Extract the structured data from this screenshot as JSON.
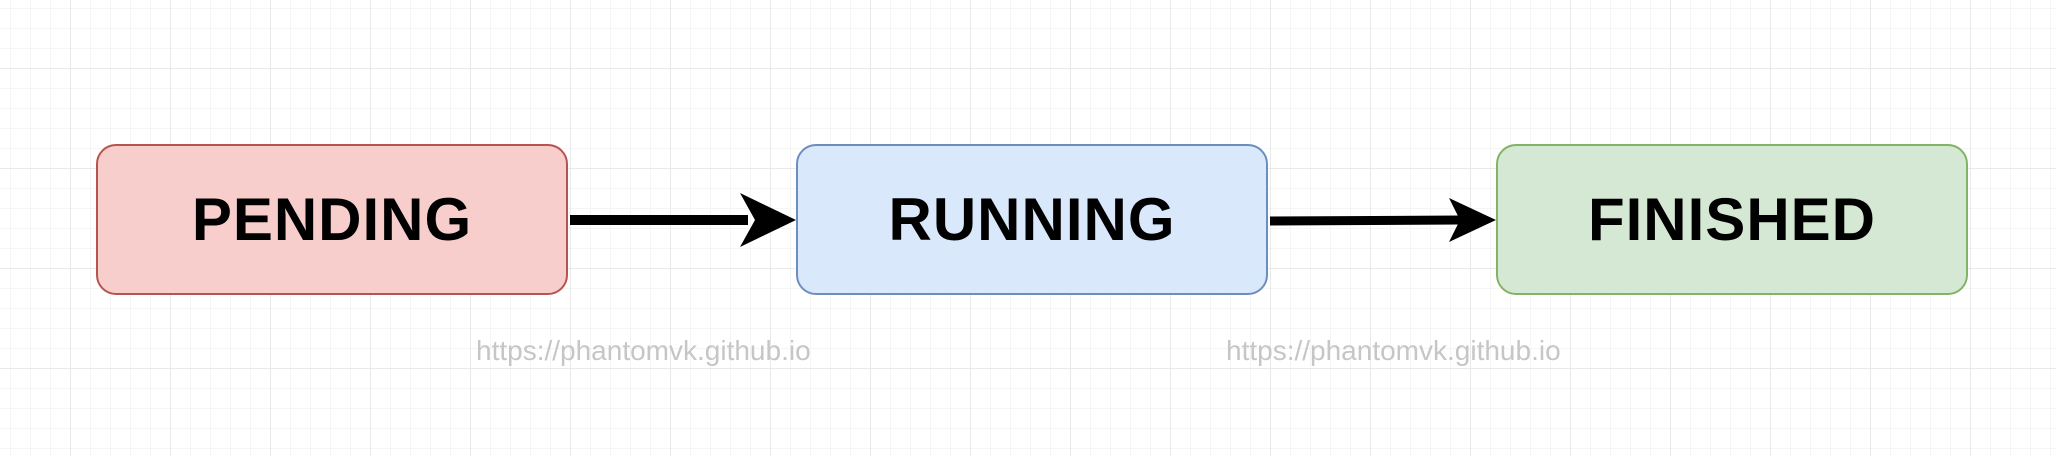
{
  "diagram": {
    "states": [
      {
        "id": "pending",
        "label": "PENDING",
        "fill": "#f8cecc",
        "stroke": "#b85450"
      },
      {
        "id": "running",
        "label": "RUNNING",
        "fill": "#dae8fc",
        "stroke": "#6c8ebf"
      },
      {
        "id": "finished",
        "label": "FINISHED",
        "fill": "#d5e8d4",
        "stroke": "#82b366"
      }
    ],
    "transitions": [
      {
        "from": "pending",
        "to": "running"
      },
      {
        "from": "running",
        "to": "finished"
      }
    ],
    "watermarks": [
      "https://phantomvk.github.io",
      "https://phantomvk.github.io"
    ],
    "colors": {
      "arrow": "#000000",
      "watermark": "#c6c6c6",
      "grid": "#e9e9e9"
    }
  }
}
